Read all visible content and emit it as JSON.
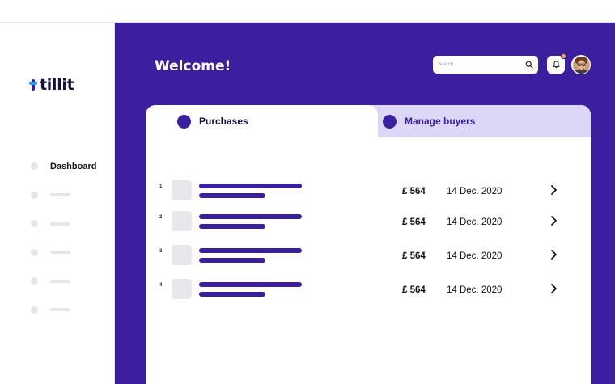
{
  "app": {
    "logo_text": "tillit"
  },
  "sidebar": {
    "items": [
      {
        "label": "Dashboard",
        "active": true
      },
      {
        "label": ""
      },
      {
        "label": ""
      },
      {
        "label": ""
      },
      {
        "label": ""
      },
      {
        "label": ""
      }
    ]
  },
  "header": {
    "title": "Welcome!",
    "search_placeholder": "Search...",
    "notification_badge": true
  },
  "tabs": [
    {
      "label": "Purchases",
      "active": true
    },
    {
      "label": "Manage buyers",
      "active": false
    }
  ],
  "purchases": [
    {
      "index": "1",
      "amount": "£ 564",
      "date": "14 Dec. 2020"
    },
    {
      "index": "2",
      "amount": "£ 564",
      "date": "14 Dec. 2020"
    },
    {
      "index": "3",
      "amount": "£ 564",
      "date": "14 Dec. 2020"
    },
    {
      "index": "4",
      "amount": "£ 564",
      "date": "14 Dec. 2020"
    }
  ],
  "colors": {
    "brand": "#3b1f9e",
    "accent": "#2a9df4",
    "badge": "#f4b23c",
    "tab_inactive": "#dcd6f7"
  }
}
